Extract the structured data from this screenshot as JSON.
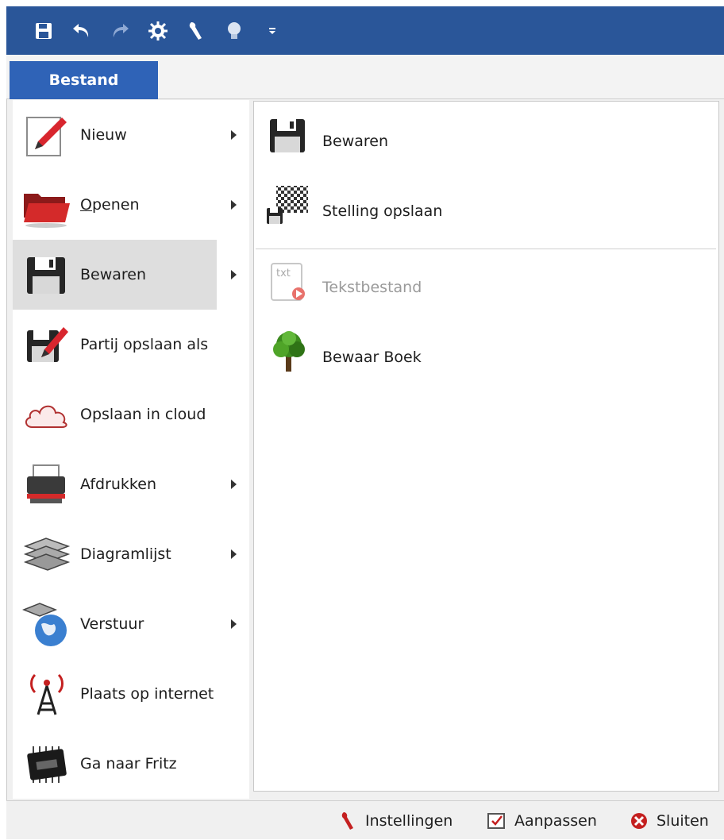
{
  "quick_access": {
    "buttons": [
      {
        "name": "save-icon"
      },
      {
        "name": "undo-icon"
      },
      {
        "name": "redo-icon"
      },
      {
        "name": "engine-icon"
      },
      {
        "name": "wrench-icon"
      },
      {
        "name": "hint-bulb-icon"
      },
      {
        "name": "customize-arrow-icon"
      }
    ]
  },
  "tabs": {
    "file_label": "Bestand"
  },
  "file_menu": {
    "items": [
      {
        "label": "Nieuw",
        "has_submenu": true,
        "icon": "new-document-icon"
      },
      {
        "label_prefix": "",
        "label_underline": "O",
        "label_rest": "penen",
        "has_submenu": true,
        "icon": "folder-open-icon"
      },
      {
        "label": "Bewaren",
        "has_submenu": true,
        "active": true,
        "icon": "floppy-disk-icon"
      },
      {
        "label": "Partij opslaan als",
        "has_submenu": false,
        "icon": "save-as-icon"
      },
      {
        "label": "Opslaan in cloud",
        "has_submenu": false,
        "icon": "cloud-icon"
      },
      {
        "label": "Afdrukken",
        "has_submenu": true,
        "icon": "printer-icon"
      },
      {
        "label": "Diagramlijst",
        "has_submenu": true,
        "icon": "chessboards-icon"
      },
      {
        "label": "Verstuur",
        "has_submenu": true,
        "icon": "globe-icon"
      },
      {
        "label": "Plaats op internet",
        "has_submenu": false,
        "icon": "antenna-icon"
      },
      {
        "label": "Ga naar Fritz",
        "has_submenu": false,
        "icon": "chip-icon"
      }
    ]
  },
  "save_submenu": {
    "items": [
      {
        "label": "Bewaren",
        "enabled": true,
        "icon": "floppy-disk-icon"
      },
      {
        "label": "Stelling opslaan",
        "enabled": true,
        "icon": "save-position-icon"
      },
      {
        "label": "Tekstbestand",
        "enabled": false,
        "icon": "text-file-icon",
        "icon_text": "txt"
      },
      {
        "label": "Bewaar Boek",
        "enabled": true,
        "icon": "tree-icon"
      }
    ]
  },
  "statusbar": {
    "settings_label": "Instellingen",
    "customize_label": "Aanpassen",
    "close_label": "Sluiten"
  },
  "colors": {
    "title_bar": "#2a5699",
    "file_tab": "#2f63b7",
    "active_item": "#dedede"
  }
}
